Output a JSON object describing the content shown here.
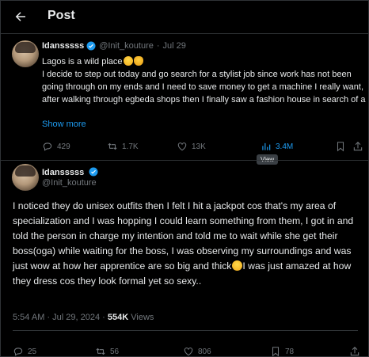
{
  "header": {
    "title": "Post",
    "back_icon": "arrow-left-icon"
  },
  "quoted_post": {
    "name": "Idansssss",
    "handle": "@Init_kouture",
    "separator": "·",
    "date": "Jul 29",
    "line1": "Lagos is a wild place",
    "emojis": [
      "weary-face",
      "weary-cat"
    ],
    "body": "I decide to step out today and go search for a stylist job since work has not been going through on my ends and I need to save money to get a machine I really want, after walking through egbeda shops then I finally saw a fashion house in search of a",
    "show_more": "Show more",
    "actions": {
      "replies": "429",
      "reposts": "1.7K",
      "likes": "13K",
      "views": "3.4M"
    },
    "tooltip": "View"
  },
  "main_post": {
    "name": "Idansssss",
    "handle": "@Init_kouture",
    "body_part1": "I noticed they do unisex outfits then I felt I hit a jackpot cos that's my area of specialization and I was hopping I could learn something from them, I got in and told the person in charge my intention and told me to wait while she get their boss(oga) while waiting for the boss, I was observing my surroundings and was just wow at how her apprentice are so big and thick",
    "body_part2": "I was just amazed at how they dress cos they look formal yet so sexy..",
    "time": "5:54 AM",
    "separator": "·",
    "date": "Jul 29, 2024",
    "views_count": "554K",
    "views_label": "Views",
    "actions": {
      "replies": "25",
      "reposts": "56",
      "likes": "806",
      "bookmarks": "78"
    }
  },
  "colors": {
    "accent": "#1d9bf0",
    "muted": "#71767b",
    "text": "#e7e9ea",
    "background": "#000000",
    "border": "#2f3336"
  }
}
